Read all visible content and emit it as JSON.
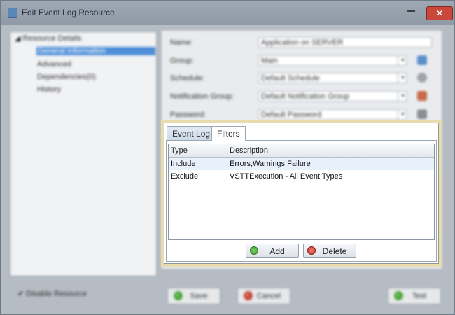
{
  "window": {
    "title": "Edit Event Log Resource",
    "close_glyph": "✕",
    "minimize_glyph": ""
  },
  "tree": {
    "root": "Resource Details",
    "items": [
      {
        "label": "General Information",
        "selected": true
      },
      {
        "label": "Advanced",
        "selected": false
      },
      {
        "label": "Dependencies(0)",
        "selected": false
      },
      {
        "label": "History",
        "selected": false
      }
    ]
  },
  "form": {
    "name_label": "Name:",
    "name_value": "Application on SERVER",
    "group_label": "Group:",
    "group_value": "Main",
    "schedule_label": "Schedule:",
    "schedule_value": "Default Schedule",
    "notification_label": "Notification Group:",
    "notification_value": "Default Notification Group",
    "password_label": "Password:",
    "password_value": "Default Password"
  },
  "tabs": [
    {
      "label": "Event Log",
      "active": false
    },
    {
      "label": "Filters",
      "active": true
    }
  ],
  "filters": {
    "columns": [
      "Type",
      "Description"
    ],
    "rows": [
      {
        "type": "Include",
        "description": "Errors,Warnings,Failure"
      },
      {
        "type": "Exclude",
        "description": "VSTTExecution - All Event Types"
      }
    ],
    "add_label": "Add",
    "delete_label": "Delete"
  },
  "footer": {
    "disable_resource_label": "Disable Resource",
    "save_label": "Save",
    "cancel_label": "Cancel",
    "test_label": "Test"
  },
  "colors": {
    "selection": "#4f8fd8",
    "dialog_highlight": "#e8dcae",
    "add_icon": "#3e9a2a",
    "delete_icon": "#c73a2c"
  }
}
